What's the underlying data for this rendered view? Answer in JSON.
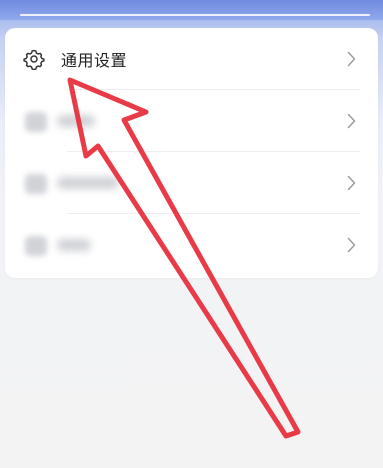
{
  "settings_list": {
    "items": [
      {
        "label": "通用设置",
        "icon": "gear-icon",
        "blurred": false
      },
      {
        "label": "",
        "icon": "blurred-icon",
        "blurred": true
      },
      {
        "label": "",
        "icon": "blurred-icon",
        "blurred": true
      },
      {
        "label": "",
        "icon": "blurred-icon",
        "blurred": true
      }
    ]
  },
  "colors": {
    "accent_arrow": "#e8303d",
    "header_gradient_top": "#6f8be0",
    "card_background": "#ffffff",
    "page_background": "#f3f3f4"
  }
}
